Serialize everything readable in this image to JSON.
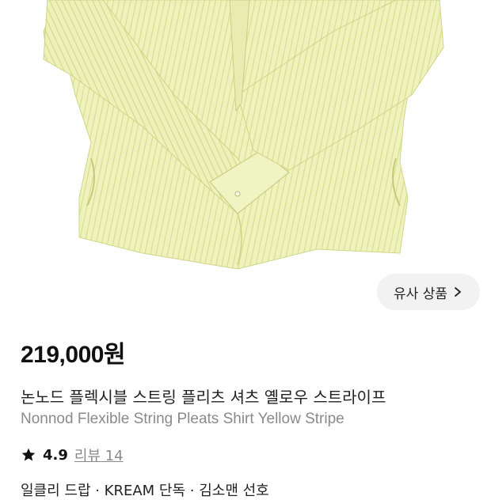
{
  "similar_button": {
    "label": "유사 상품",
    "icon": "chevron-right-icon"
  },
  "product": {
    "price": "219,000원",
    "name_ko": "논노드 플렉시블 스트링 플리츠 셔츠 옐로우 스트라이프",
    "name_en": "Nonnod Flexible String Pleats Shirt Yellow Stripe",
    "rating": "4.9",
    "rating_icon": "star-icon",
    "review_label": "리뷰 14",
    "tags": "일클리 드랍 · KREAM 단독 · 김소맨 선호"
  },
  "colors": {
    "shirt": "#eef1b8",
    "stripe": "#d9df8c",
    "button_bg": "#f2f2f2",
    "muted_text": "#8a8a8a"
  }
}
